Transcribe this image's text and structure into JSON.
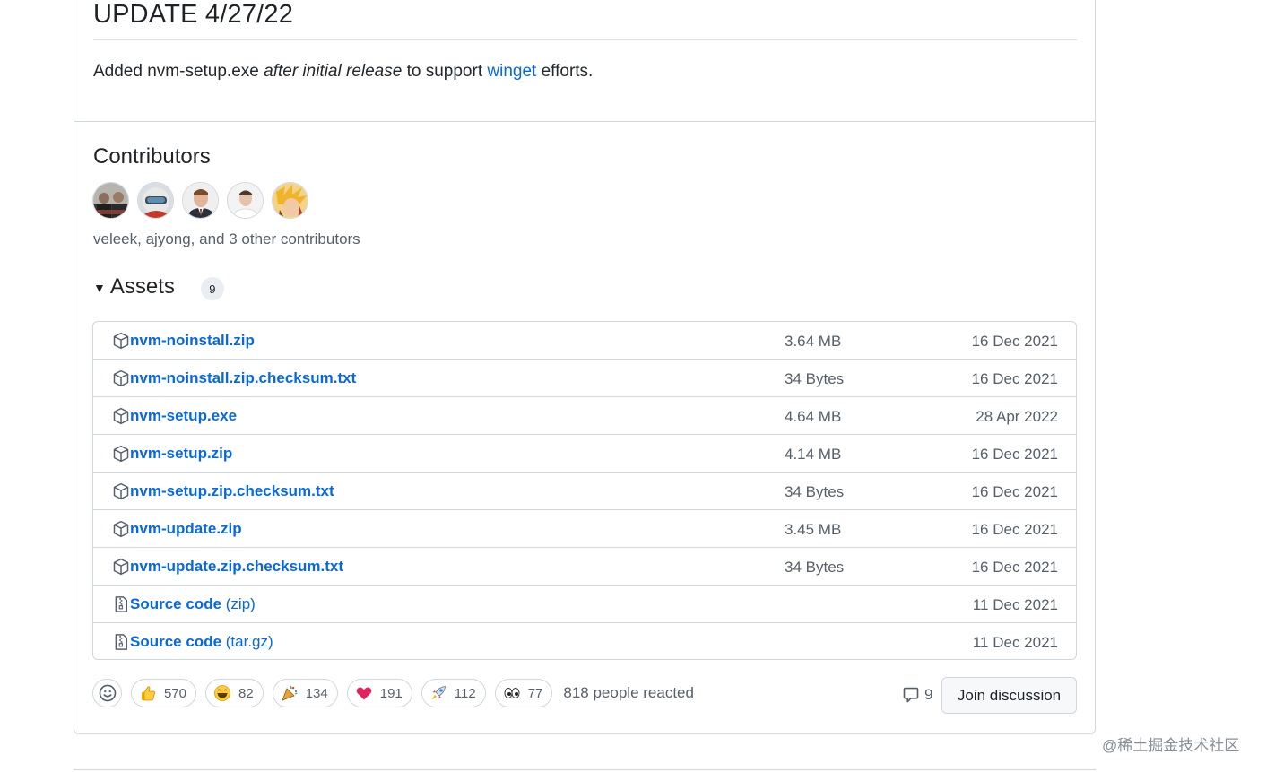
{
  "update": {
    "title": "UPDATE 4/27/22",
    "body_prefix": "Added nvm-setup.exe ",
    "body_em": "after initial release",
    "body_mid": " to support ",
    "body_link": "winget",
    "body_suffix": " efforts."
  },
  "contributors": {
    "title": "Contributors",
    "summary": "veleek, ajyong, and 3 other contributors",
    "avatars": [
      "veleek",
      "ajyong",
      "contributor-3",
      "contributor-4",
      "contributor-5"
    ]
  },
  "assets": {
    "title": "Assets",
    "count": "9",
    "items": [
      {
        "name": "nvm-noinstall.zip",
        "suffix": "",
        "size": "3.64 MB",
        "date": "16 Dec 2021",
        "icon": "package-icon"
      },
      {
        "name": "nvm-noinstall.zip.checksum.txt",
        "suffix": "",
        "size": "34 Bytes",
        "date": "16 Dec 2021",
        "icon": "package-icon"
      },
      {
        "name": "nvm-setup.exe",
        "suffix": "",
        "size": "4.64 MB",
        "date": "28 Apr 2022",
        "icon": "package-icon"
      },
      {
        "name": "nvm-setup.zip",
        "suffix": "",
        "size": "4.14 MB",
        "date": "16 Dec 2021",
        "icon": "package-icon"
      },
      {
        "name": "nvm-setup.zip.checksum.txt",
        "suffix": "",
        "size": "34 Bytes",
        "date": "16 Dec 2021",
        "icon": "package-icon"
      },
      {
        "name": "nvm-update.zip",
        "suffix": "",
        "size": "3.45 MB",
        "date": "16 Dec 2021",
        "icon": "package-icon"
      },
      {
        "name": "nvm-update.zip.checksum.txt",
        "suffix": "",
        "size": "34 Bytes",
        "date": "16 Dec 2021",
        "icon": "package-icon"
      },
      {
        "name": "Source code",
        "suffix": " (zip)",
        "size": "",
        "date": "11 Dec 2021",
        "icon": "file-zip-icon"
      },
      {
        "name": "Source code",
        "suffix": " (tar.gz)",
        "size": "",
        "date": "11 Dec 2021",
        "icon": "file-zip-icon"
      }
    ]
  },
  "reactions": {
    "items": [
      {
        "emoji": "thumbs-up-icon",
        "count": "570"
      },
      {
        "emoji": "laugh-icon",
        "count": "82"
      },
      {
        "emoji": "hooray-icon",
        "count": "134"
      },
      {
        "emoji": "heart-icon",
        "count": "191"
      },
      {
        "emoji": "rocket-icon",
        "count": "112"
      },
      {
        "emoji": "eyes-icon",
        "count": "77"
      }
    ],
    "summary": "818 people reacted"
  },
  "discussion": {
    "comment_count": "9",
    "join_label": "Join discussion"
  },
  "watermark": "@稀土掘金技术社区",
  "colors": {
    "link": "#0969da",
    "muted": "#57606a",
    "border": "#d0d7de",
    "text": "#1f2328"
  }
}
